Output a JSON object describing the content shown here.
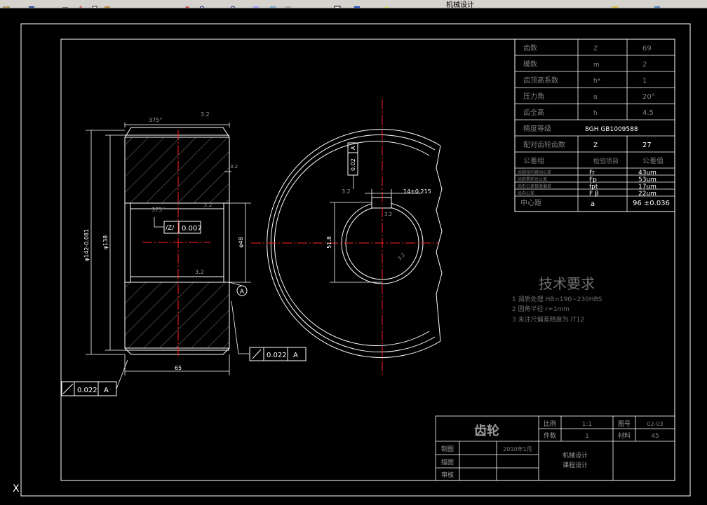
{
  "app": {
    "toolbar": {
      "file_label": "机械设计",
      "icons": [
        "open-icon",
        "save-icon",
        "print-icon",
        "cut-icon",
        "copy-icon",
        "paste-icon",
        "undo-icon",
        "redo-icon",
        "pan-icon",
        "zoom-icon",
        "zoom-window-icon",
        "properties-icon",
        "layer-icon",
        "text-style-icon",
        "table-icon",
        "help-icon",
        "layer-dropdown-icon",
        "color-icon",
        "linetype-icon"
      ]
    }
  },
  "drawing": {
    "title_block": {
      "part_name": "齿轮",
      "scale_label": "比例",
      "scale_value": "1:1",
      "drawing_no_label": "图号",
      "drawing_no_value": "02-03",
      "qty_label": "件数",
      "qty_value": "1",
      "material_label": "材料",
      "material_value": "45",
      "drawn_label": "制图",
      "drawn_date": "2010年1月",
      "checked_label": "描图",
      "reviewed_label": "审核",
      "course_line1": "机械设计",
      "course_line2": "课程设计"
    },
    "params_table": {
      "rows": [
        {
          "name": "齿数",
          "sym": "Z",
          "val": "69"
        },
        {
          "name": "模数",
          "sym": "m",
          "val": "2"
        },
        {
          "name": "齿顶高系数",
          "sym": "h*",
          "val": "1"
        },
        {
          "name": "压力角",
          "sym": "α",
          "val": "20°"
        },
        {
          "name": "齿全高",
          "sym": "h",
          "val": "4.5"
        },
        {
          "name": "精度等级",
          "sym": "8GH GB1009588",
          "val": ""
        },
        {
          "name": "配对齿轮齿数",
          "sym": "Z",
          "val": "27"
        },
        {
          "name": "公差组",
          "sym": "检验项目",
          "val": "公差值"
        }
      ],
      "tol_rows": [
        {
          "name": "齿圈径向跳动公差",
          "sym": "Fr",
          "val": "43um"
        },
        {
          "name": "齿距累积总公差",
          "sym": "Fp",
          "val": "53um"
        },
        {
          "name": "齿形公差极限偏差",
          "sym": "fpt",
          "val": "17um"
        },
        {
          "name": "齿向公差",
          "sym": "F β",
          "val": "22um"
        }
      ],
      "center_row": {
        "name": "中心距",
        "sym": "a",
        "val": "96 ±0.036"
      }
    },
    "tech_req": {
      "title": "技术要求",
      "items": [
        "1 调质处理 HB=190~230HBS",
        "2 圆角半径 r=1mm",
        "3 未注尺偏差精度为 IT12"
      ]
    },
    "dims": {
      "chamfer_top": "375°",
      "roughness_top": "3.2",
      "roughness_side": "3.2",
      "chamfer_inner": "375°",
      "roughness_inner": "3.2",
      "roughness_bottom": "3.2",
      "outer_dia": "φ142-0.081",
      "root_dia": "φ138",
      "bore_dia": "φ48",
      "width": "65",
      "flat_tol_symbol": "/Z/",
      "flat_tol_value": "0.007",
      "runout_right_value": "0.022",
      "runout_right_datum": "A",
      "runout_left_value": "0.022",
      "runout_left_datum": "A",
      "datum_a": "A",
      "keyway_width": "14±0.215",
      "keyway_depth": "51.8",
      "keyway_sym_value": "0.02",
      "keyway_sym_datum": "A",
      "keyway_rough": "3.2",
      "front_rough": "3.2",
      "front_rough2": "3.2"
    },
    "ucs_label": "X"
  },
  "colors": {
    "background": "#000000",
    "lines": "#ffffff",
    "center": "#ff0000",
    "dim": "#ffffff",
    "table_text": "#7f7f7f"
  }
}
